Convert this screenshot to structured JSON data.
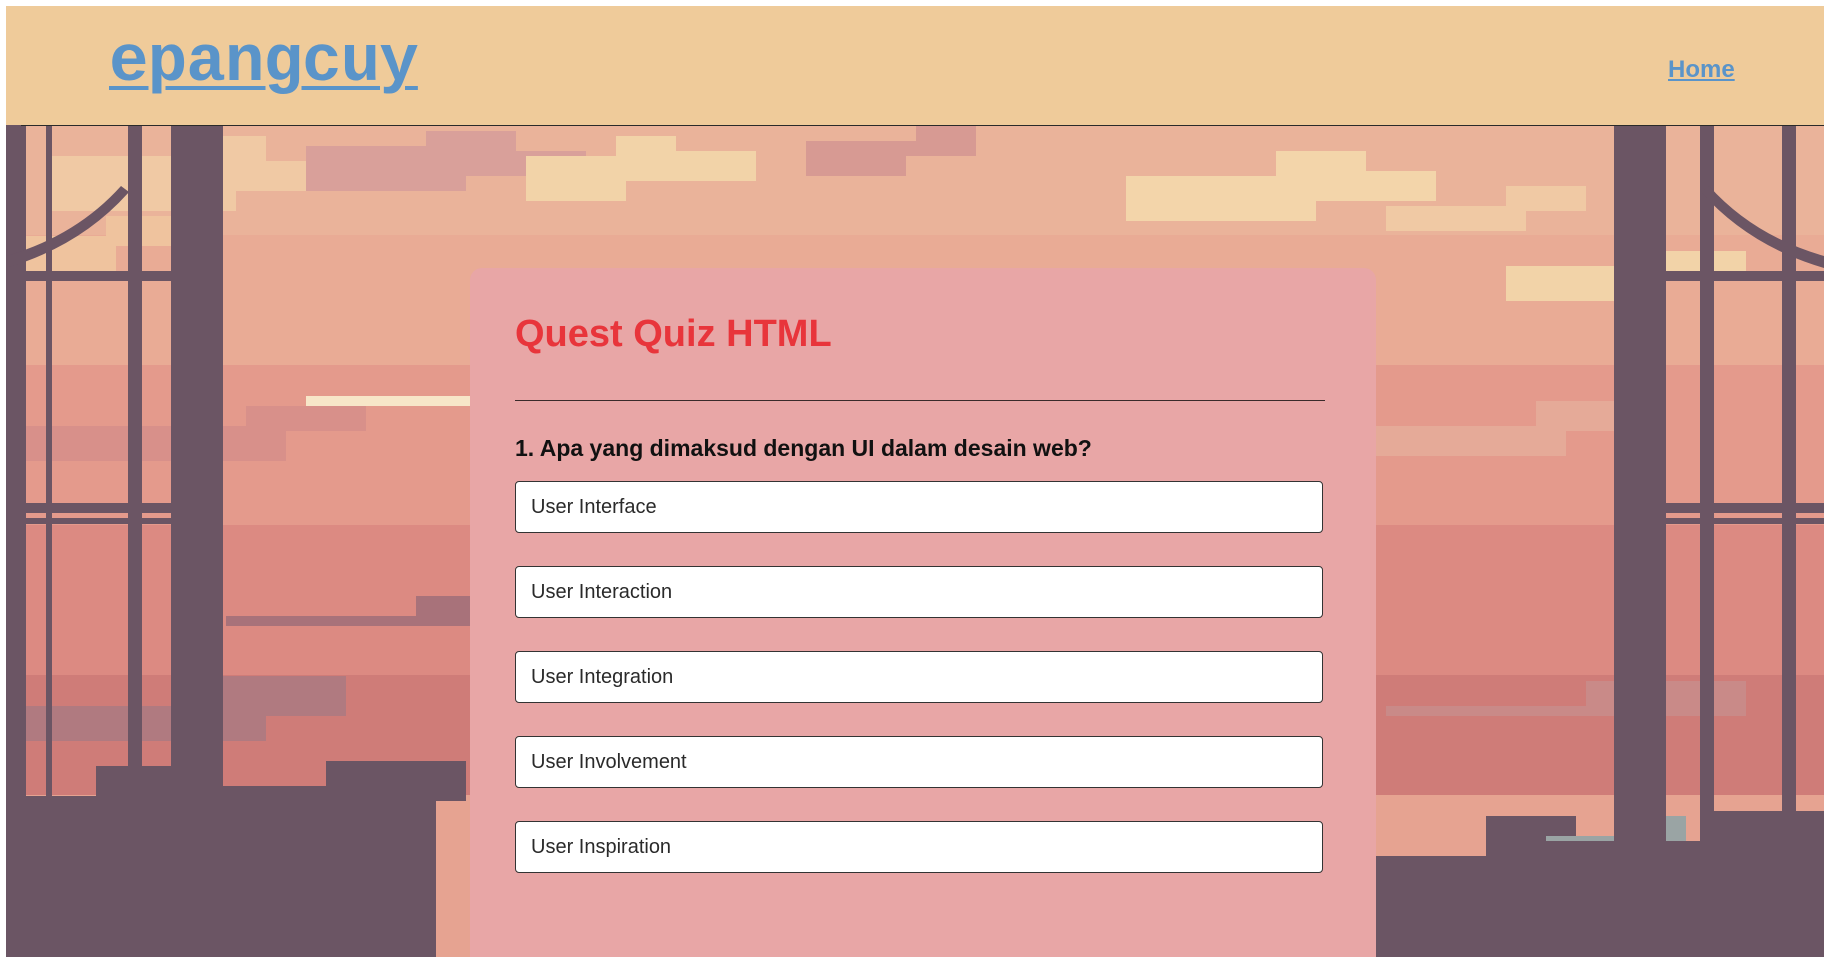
{
  "header": {
    "logo_text": "epangcuy",
    "nav": {
      "home_label": "Home"
    }
  },
  "quiz": {
    "title": "Quest Quiz HTML",
    "question": {
      "text": "1. Apa yang dimaksud dengan UI dalam desain web?",
      "options": [
        "User Interface",
        "User Interaction",
        "User Integration",
        "User Involvement",
        "User Inspiration"
      ]
    }
  },
  "colors": {
    "header_bg": "#efcb9a",
    "logo": "#5a94c9",
    "card_bg": "#e8a6a6",
    "title": "#e8353b",
    "sky": "#e6a391",
    "window_frame": "#6b5564"
  }
}
